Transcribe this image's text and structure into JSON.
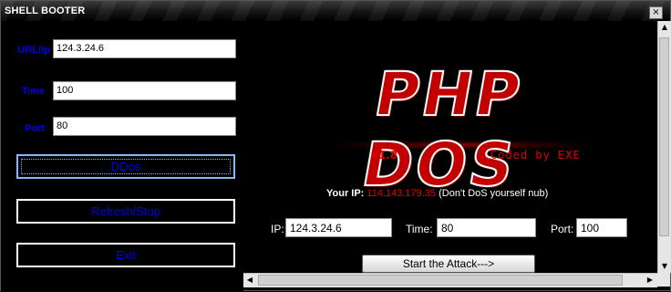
{
  "window": {
    "title": "SHELL BOOTER",
    "close_glyph": "×"
  },
  "form": {
    "url_label": "URL/Ip",
    "url_value": "124.3.24.6",
    "time_label": "Time",
    "time_value": "100",
    "port_label": "Port",
    "port_value": "80"
  },
  "buttons": {
    "ddos": "DDos",
    "refresh_stop": "Refresh/Stop",
    "exit": "Exit"
  },
  "banner": {
    "logo": "PHP DOS",
    "version": "v1.8",
    "credit": "Coded by EXE"
  },
  "info": {
    "your_ip_label": "Your IP:",
    "your_ip_value": "114.143.179.35",
    "your_ip_note": "(Don't DoS yourself nub)"
  },
  "attack": {
    "ip_label": "IP:",
    "ip_value": "124.3.24.6",
    "time_label": "Time:",
    "time_value": "80",
    "port_label": "Port:",
    "port_value": "100",
    "start_label": "Start the Attack--->"
  },
  "scroll": {
    "up": "▲",
    "down": "▼",
    "left": "◀",
    "right": "▶"
  },
  "colors": {
    "label_blue": "#0000e6",
    "accent_red": "#e00000"
  },
  "icons": [
    "close-icon",
    "scroll-up-icon",
    "scroll-down-icon",
    "scroll-left-icon",
    "scroll-right-icon"
  ]
}
